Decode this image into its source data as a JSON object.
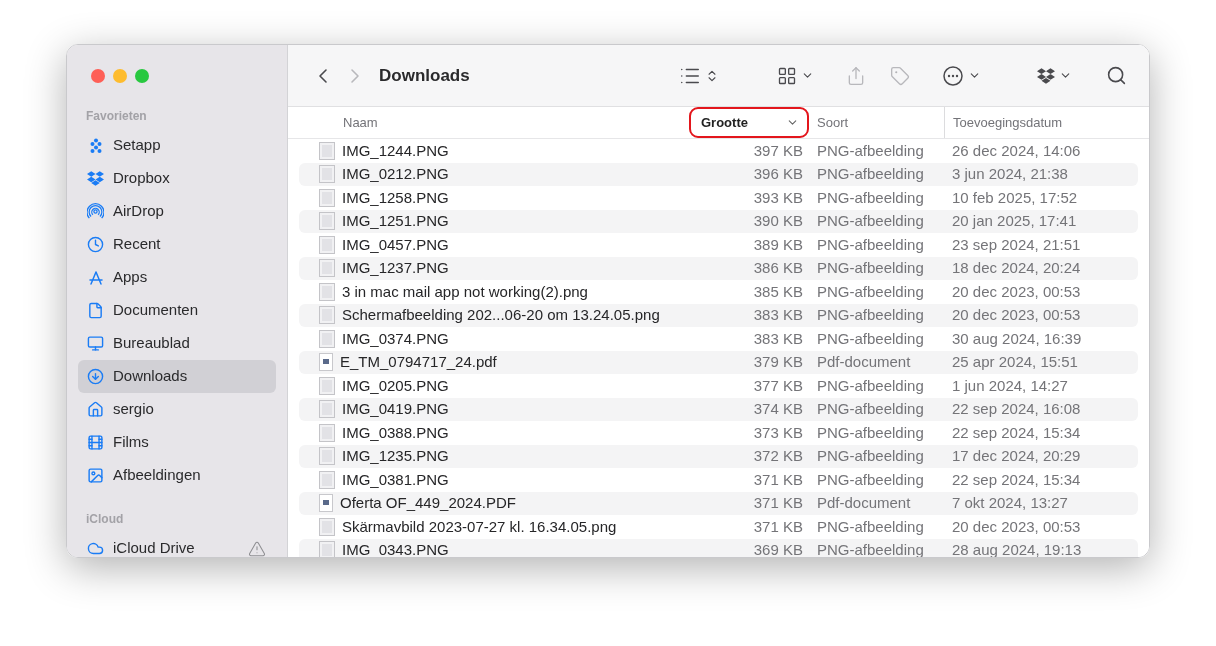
{
  "sidebar": {
    "sections": [
      {
        "title": "Favorieten",
        "items": [
          {
            "label": "Setapp",
            "selected": false
          },
          {
            "label": "Dropbox",
            "selected": false
          },
          {
            "label": "AirDrop",
            "selected": false
          },
          {
            "label": "Recent",
            "selected": false
          },
          {
            "label": "Apps",
            "selected": false
          },
          {
            "label": "Documenten",
            "selected": false
          },
          {
            "label": "Bureaublad",
            "selected": false
          },
          {
            "label": "Downloads",
            "selected": true
          },
          {
            "label": "sergio",
            "selected": false
          },
          {
            "label": "Films",
            "selected": false
          },
          {
            "label": "Afbeeldingen",
            "selected": false
          }
        ]
      },
      {
        "title": "iCloud",
        "items": [
          {
            "label": "iCloud Drive",
            "selected": false,
            "warning": true
          }
        ]
      }
    ]
  },
  "toolbar": {
    "title": "Downloads",
    "buttons": [
      {
        "kind": "back",
        "disabled": false
      },
      {
        "kind": "forward",
        "disabled": true
      },
      {
        "kind": "view",
        "disabled": false
      },
      {
        "kind": "group",
        "disabled": false
      },
      {
        "kind": "share",
        "disabled": true
      },
      {
        "kind": "tag",
        "disabled": true
      },
      {
        "kind": "more",
        "disabled": false
      },
      {
        "kind": "dropbox",
        "disabled": false
      },
      {
        "kind": "search",
        "disabled": false
      }
    ]
  },
  "table": {
    "columns": [
      {
        "label": "Naam",
        "sorted": false,
        "highlighted": false
      },
      {
        "label": "Grootte",
        "sorted": true,
        "highlighted": true
      },
      {
        "label": "Soort",
        "sorted": false,
        "highlighted": false
      },
      {
        "label": "Toevoegingsdatum",
        "sorted": false,
        "highlighted": false
      }
    ],
    "rows": [
      {
        "name": "IMG_1244.PNG",
        "size": "397 KB",
        "type": "PNG-afbeelding",
        "date_added": "26 dec 2024, 14:06",
        "kind": "image"
      },
      {
        "name": "IMG_0212.PNG",
        "size": "396 KB",
        "type": "PNG-afbeelding",
        "date_added": "3 jun 2024, 21:38",
        "kind": "image"
      },
      {
        "name": "IMG_1258.PNG",
        "size": "393 KB",
        "type": "PNG-afbeelding",
        "date_added": "10 feb 2025, 17:52",
        "kind": "image"
      },
      {
        "name": "IMG_1251.PNG",
        "size": "390 KB",
        "type": "PNG-afbeelding",
        "date_added": "20 jan 2025, 17:41",
        "kind": "image"
      },
      {
        "name": "IMG_0457.PNG",
        "size": "389 KB",
        "type": "PNG-afbeelding",
        "date_added": "23 sep 2024, 21:51",
        "kind": "image"
      },
      {
        "name": "IMG_1237.PNG",
        "size": "386 KB",
        "type": "PNG-afbeelding",
        "date_added": "18 dec 2024, 20:24",
        "kind": "image"
      },
      {
        "name": "3 in mac mail app not working(2).png",
        "size": "385 KB",
        "type": "PNG-afbeelding",
        "date_added": "20 dec 2023, 00:53",
        "kind": "image"
      },
      {
        "name": "Schermafbeelding 202...06-20 om 13.24.05.png",
        "size": "383 KB",
        "type": "PNG-afbeelding",
        "date_added": "20 dec 2023, 00:53",
        "kind": "image"
      },
      {
        "name": "IMG_0374.PNG",
        "size": "383 KB",
        "type": "PNG-afbeelding",
        "date_added": "30 aug 2024, 16:39",
        "kind": "image"
      },
      {
        "name": "E_TM_0794717_24.pdf",
        "size": "379 KB",
        "type": "Pdf-document",
        "date_added": "25 apr 2024, 15:51",
        "kind": "pdf"
      },
      {
        "name": "IMG_0205.PNG",
        "size": "377 KB",
        "type": "PNG-afbeelding",
        "date_added": "1 jun 2024, 14:27",
        "kind": "image"
      },
      {
        "name": "IMG_0419.PNG",
        "size": "374 KB",
        "type": "PNG-afbeelding",
        "date_added": "22 sep 2024, 16:08",
        "kind": "image"
      },
      {
        "name": "IMG_0388.PNG",
        "size": "373 KB",
        "type": "PNG-afbeelding",
        "date_added": "22 sep 2024, 15:34",
        "kind": "image"
      },
      {
        "name": "IMG_1235.PNG",
        "size": "372 KB",
        "type": "PNG-afbeelding",
        "date_added": "17 dec 2024, 20:29",
        "kind": "image"
      },
      {
        "name": "IMG_0381.PNG",
        "size": "371 KB",
        "type": "PNG-afbeelding",
        "date_added": "22 sep 2024, 15:34",
        "kind": "image"
      },
      {
        "name": "Oferta OF_449_2024.PDF",
        "size": "371 KB",
        "type": "Pdf-document",
        "date_added": "7 okt 2024, 13:27",
        "kind": "pdf"
      },
      {
        "name": "Skärmavbild 2023-07-27 kl. 16.34.05.png",
        "size": "371 KB",
        "type": "PNG-afbeelding",
        "date_added": "20 dec 2023, 00:53",
        "kind": "image"
      },
      {
        "name": "IMG_0343.PNG",
        "size": "369 KB",
        "type": "PNG-afbeelding",
        "date_added": "28 aug 2024, 19:13",
        "kind": "image"
      }
    ]
  }
}
